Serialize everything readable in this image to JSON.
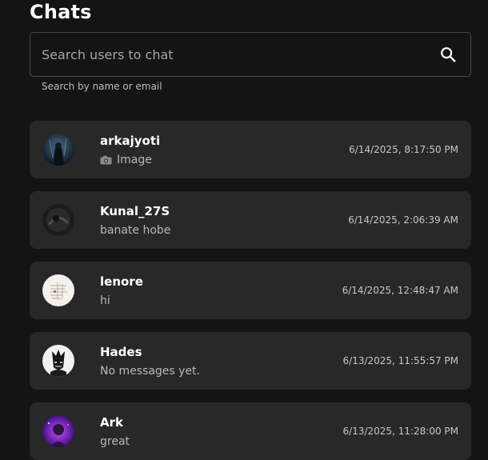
{
  "header": {
    "title": "Chats"
  },
  "search": {
    "placeholder": "Search users to chat",
    "value": "",
    "helper": "Search by name or email"
  },
  "chats": [
    {
      "name": "arkajyoti",
      "preview": "Image",
      "preview_icon": "camera-icon",
      "time": "6/14/2025, 8:17:50 PM"
    },
    {
      "name": "Kunal_27S",
      "preview": "banate hobe",
      "time": "6/14/2025, 2:06:39 AM"
    },
    {
      "name": "lenore",
      "preview": "hi",
      "time": "6/14/2025, 12:48:47 AM"
    },
    {
      "name": "Hades",
      "preview": "No messages yet.",
      "time": "6/13/2025, 11:55:57 PM"
    },
    {
      "name": "Ark",
      "preview": "great",
      "time": "6/13/2025, 11:28:00 PM"
    }
  ],
  "colors": {
    "background": "#141414",
    "card": "#282828",
    "border": "#4a4a4a",
    "text_secondary": "#b8b8b8"
  }
}
